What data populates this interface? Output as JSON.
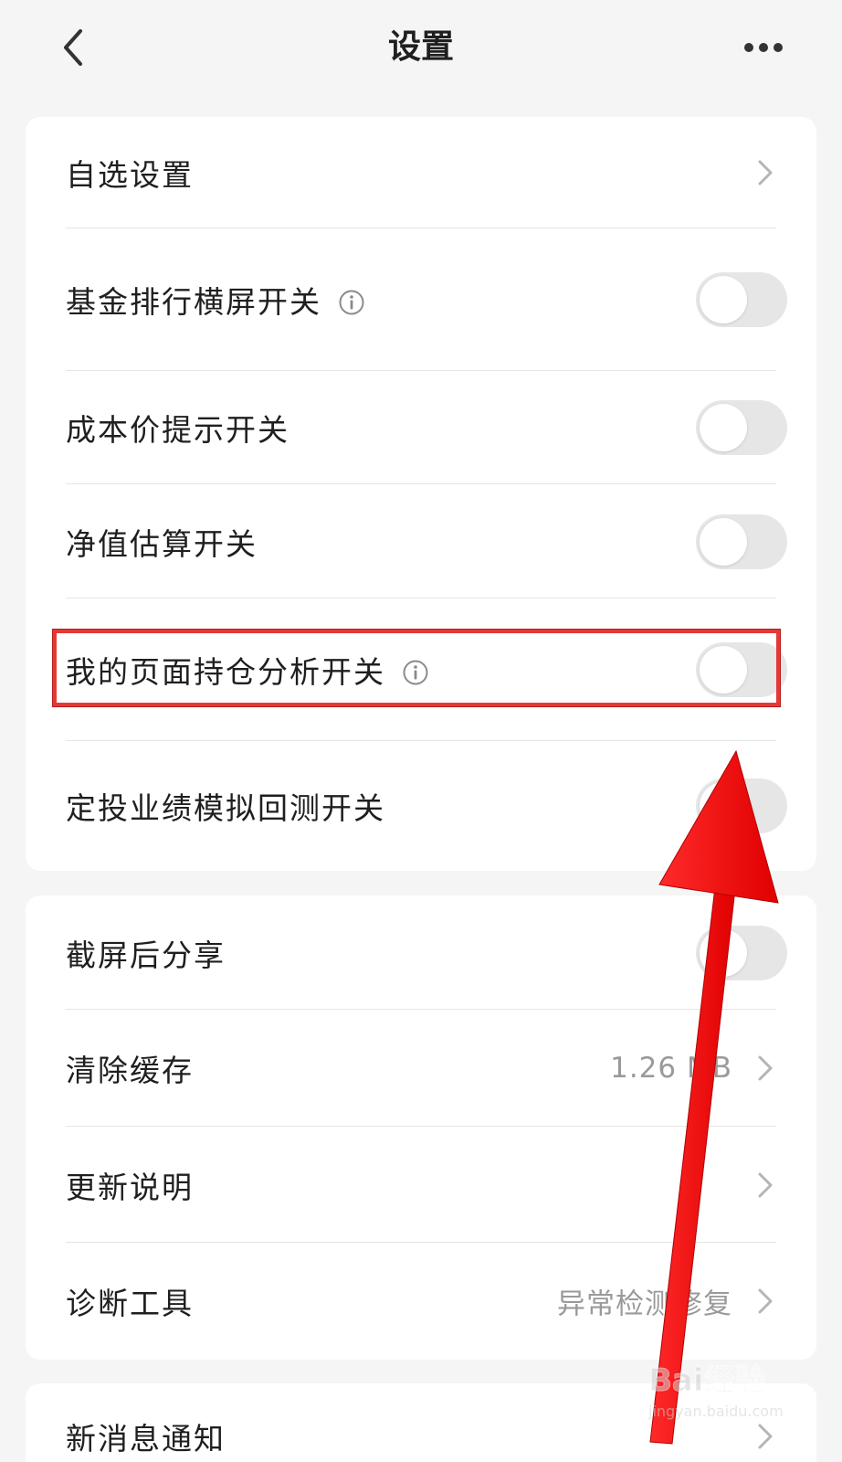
{
  "header": {
    "title": "设置"
  },
  "icons": {
    "back": "chevron-left-icon",
    "more": "more-horizontal-icon",
    "info": "info-icon",
    "chevron": "chevron-right-icon"
  },
  "colors": {
    "background": "#f5f5f5",
    "card": "#ffffff",
    "toggle_off": "#e6e6e6",
    "secondary_text": "#9a9a9a",
    "annotation_red": "#e53935"
  },
  "group1": [
    {
      "label": "自选设置",
      "control": "chevron"
    },
    {
      "label": "基金排行横屏开关",
      "control": "toggle",
      "on": false,
      "info": true
    },
    {
      "label": "成本价提示开关",
      "control": "toggle",
      "on": false
    },
    {
      "label": "净值估算开关",
      "control": "toggle",
      "on": false
    },
    {
      "label": "我的页面持仓分析开关",
      "control": "toggle",
      "on": false,
      "info": true,
      "highlighted": true
    },
    {
      "label": "定投业绩模拟回测开关",
      "control": "toggle",
      "on": false
    }
  ],
  "group2": [
    {
      "label": "截屏后分享",
      "control": "toggle",
      "on": false
    },
    {
      "label": "清除缓存",
      "value": "1.26 MB",
      "control": "chevron"
    },
    {
      "label": "更新说明",
      "control": "chevron"
    },
    {
      "label": "诊断工具",
      "value": "异常检测修复",
      "control": "chevron"
    }
  ],
  "group3": [
    {
      "label": "新消息通知",
      "control": "chevron"
    }
  ],
  "watermark": {
    "text": "Bai经验",
    "subtext": "jingyan.baidu.com"
  }
}
